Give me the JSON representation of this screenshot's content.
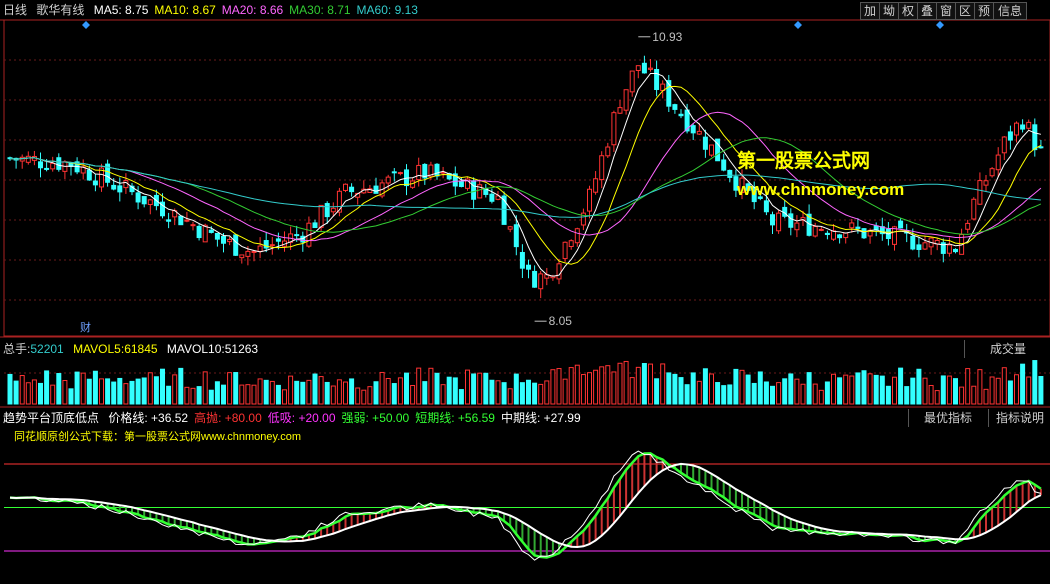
{
  "header": {
    "period": "日线",
    "stock": "歌华有线",
    "ma": [
      {
        "label": "MA5:",
        "value": "8.75",
        "color": "#ffffff"
      },
      {
        "label": "MA10:",
        "value": "8.67",
        "color": "#ffff00"
      },
      {
        "label": "MA20:",
        "value": "8.66",
        "color": "#ff66ff"
      },
      {
        "label": "MA30:",
        "value": "8.71",
        "color": "#33cc33"
      },
      {
        "label": "MA60:",
        "value": "9.13",
        "color": "#33cccc"
      }
    ],
    "buttons": [
      "加",
      "坳",
      "权",
      "叠",
      "窗",
      "区",
      "预",
      "信息"
    ]
  },
  "watermark": {
    "line1": "第一股票公式网",
    "line2": "www.chnmoney.com"
  },
  "annotations": {
    "high": "10.93",
    "low": "8.05",
    "fin": "财"
  },
  "volume": {
    "label": "总手:",
    "value": "52201",
    "mavol5_label": "MAVOL5:",
    "mavol5": "61845",
    "mavol10_label": "MAVOL10:",
    "mavol10": "51263",
    "button": "成交量"
  },
  "indicator": {
    "title": "趋势平台顶底低点",
    "items": [
      {
        "label": "价格线:",
        "value": "+36.52",
        "color": "#ffffff"
      },
      {
        "label": "高抛:",
        "value": "+80.00",
        "color": "#ff3333"
      },
      {
        "label": "低吸:",
        "value": "+20.00",
        "color": "#ff33ff"
      },
      {
        "label": "强弱:",
        "value": "+50.00",
        "color": "#33ff33"
      },
      {
        "label": "短期线:",
        "value": "+56.59",
        "color": "#33ff33"
      },
      {
        "label": "中期线:",
        "value": "+27.99",
        "color": "#ffffff"
      }
    ],
    "subtitle": "同花顺原创公式下载：第一股票公式网www.chnmoney.com",
    "btn1": "最优指标",
    "btn2": "指标说明"
  },
  "chart_data": [
    {
      "type": "candlestick",
      "ylim": [
        7.9,
        11.1
      ],
      "high_mark": 10.93,
      "low_mark": 8.05,
      "legend": [
        "MA5",
        "MA10",
        "MA20",
        "MA30",
        "MA60"
      ],
      "ma_colors": {
        "MA5": "#ffffff",
        "MA10": "#ffff00",
        "MA20": "#ff66ff",
        "MA30": "#33cc33",
        "MA60": "#33cccc"
      }
    },
    {
      "type": "bar",
      "series": [
        "总手",
        "MAVOL5",
        "MAVOL10"
      ]
    },
    {
      "type": "line",
      "levels": {
        "高抛": 80,
        "强弱": 50,
        "低吸": 20
      },
      "ylim": [
        0,
        100
      ],
      "series": [
        "价格线",
        "短期线",
        "中期线"
      ]
    }
  ]
}
